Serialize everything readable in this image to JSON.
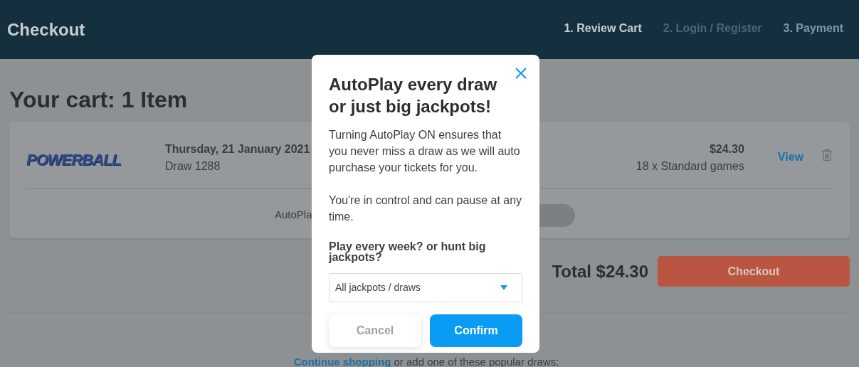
{
  "header": {
    "title": "Checkout",
    "steps": [
      {
        "label": "1. Review Cart",
        "kind": "current"
      },
      {
        "label": "2. Login / Register",
        "kind": "inactive"
      },
      {
        "label": "3. Payment",
        "kind": "upcoming"
      }
    ]
  },
  "cart": {
    "heading": "Your cart: 1 Item",
    "item": {
      "logo": "POWERBALL",
      "date": "Thursday, 21 January 2021",
      "draw": "Draw 1288",
      "price": "$24.30",
      "games": "18 x Standard games",
      "view": "View",
      "autoplay_label": "AutoPla",
      "autoplay_on": false
    },
    "total": "Total $24.30",
    "checkout_button": "Checkout",
    "footer": {
      "link": "Continue shopping",
      "text": " or add one of these popular draws:"
    }
  },
  "modal": {
    "title": "AutoPlay every draw or just big jackpots!",
    "paragraphs": [
      "Turning AutoPlay ON ensures that you never miss a draw as we will auto purchase your tickets for you.",
      "You're in control and can pause at any time."
    ],
    "select_label": "Play every week? or hunt big jackpots?",
    "select_value": "All jackpots / draws",
    "buttons": [
      {
        "label": "Cancel",
        "kind": "secondary"
      },
      {
        "label": "Confirm",
        "kind": "primary"
      }
    ]
  }
}
